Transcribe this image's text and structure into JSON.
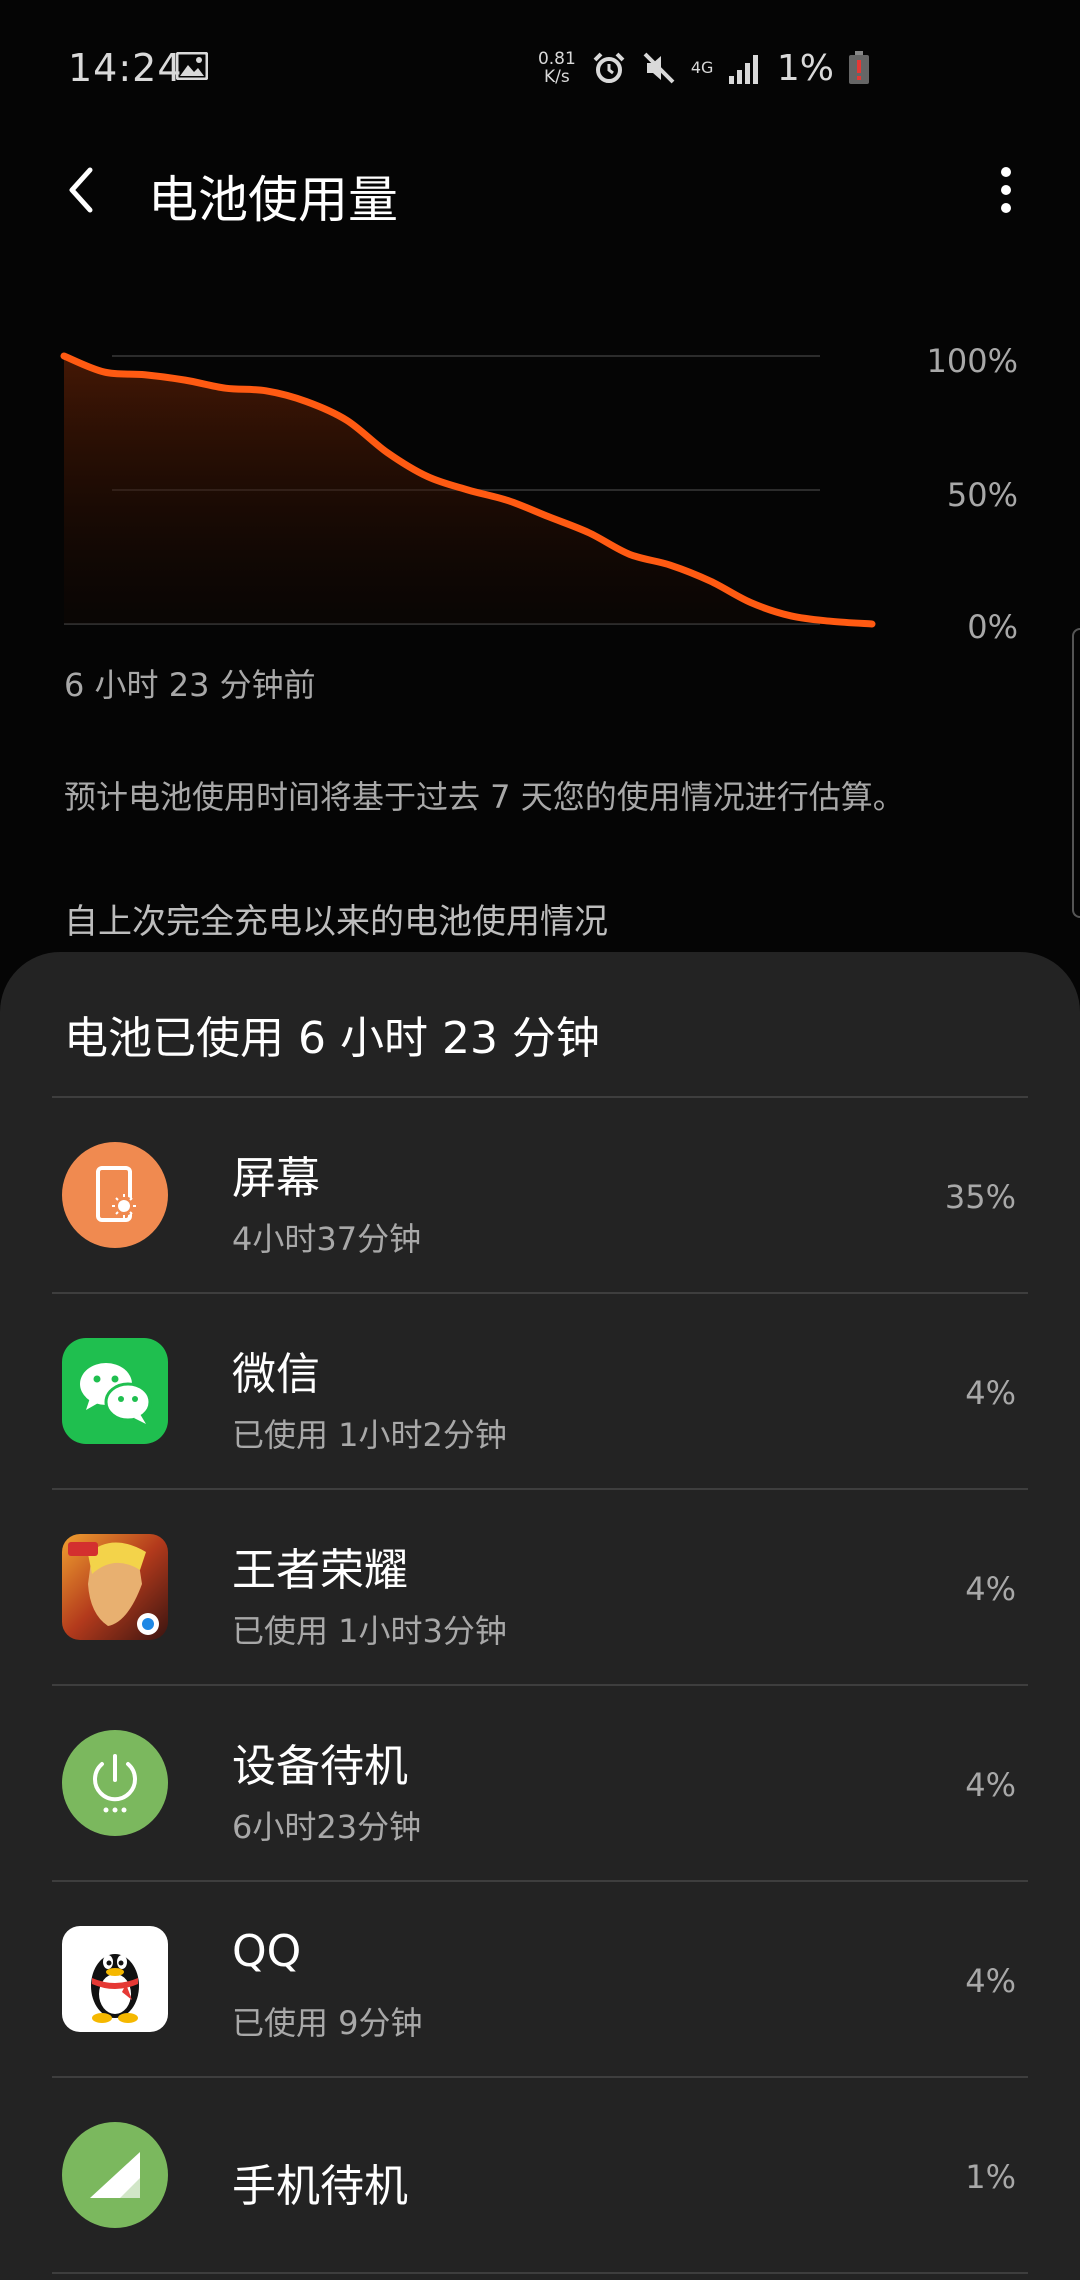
{
  "status_bar": {
    "time": "14:24",
    "net_speed_value": "0.81",
    "net_speed_unit": "K/s",
    "network_type": "4G",
    "battery_percent": "1%"
  },
  "header": {
    "title": "电池使用量"
  },
  "chart_data": {
    "type": "area",
    "y_ticks": [
      "100%",
      "50%",
      "0%"
    ],
    "ylim": [
      0,
      100
    ],
    "x": [
      0,
      5,
      10,
      15,
      20,
      25,
      30,
      35,
      40,
      45,
      50,
      55,
      60,
      65,
      70,
      75,
      80,
      85,
      90,
      95,
      100
    ],
    "values": [
      100,
      94,
      93,
      91,
      88,
      87,
      83,
      76,
      64,
      55,
      50,
      46,
      40,
      34,
      26,
      22,
      16,
      8,
      3,
      1,
      0
    ],
    "x_label_start": "6 小时 23 分钟前",
    "line_color": "#ff5a12"
  },
  "estimate_note": "预计电池使用时间将基于过去 7 天您的使用情况进行估算。",
  "section_header": "自上次完全充电以来的电池使用情况",
  "sheet": {
    "title": "电池已使用 6 小时 23 分钟",
    "items": [
      {
        "name": "屏幕",
        "detail": "4小时37分钟",
        "percent": "35%",
        "icon": "screen-icon",
        "icon_color": "#f08a50"
      },
      {
        "name": "微信",
        "detail": "已使用 1小时2分钟",
        "percent": "4%",
        "icon": "wechat-icon",
        "icon_color": "#1fbf4f"
      },
      {
        "name": "王者荣耀",
        "detail": "已使用 1小时3分钟",
        "percent": "4%",
        "icon": "honor-of-kings-icon",
        "icon_color": "#b33a1c"
      },
      {
        "name": "设备待机",
        "detail": "6小时23分钟",
        "percent": "4%",
        "icon": "power-icon",
        "icon_color": "#7bb85e"
      },
      {
        "name": "QQ",
        "detail": "已使用 9分钟",
        "percent": "4%",
        "icon": "qq-penguin-icon",
        "icon_color": "#ffffff"
      },
      {
        "name": "手机待机",
        "detail": "",
        "percent": "1%",
        "icon": "signal-icon",
        "icon_color": "#7bb85e"
      }
    ]
  }
}
